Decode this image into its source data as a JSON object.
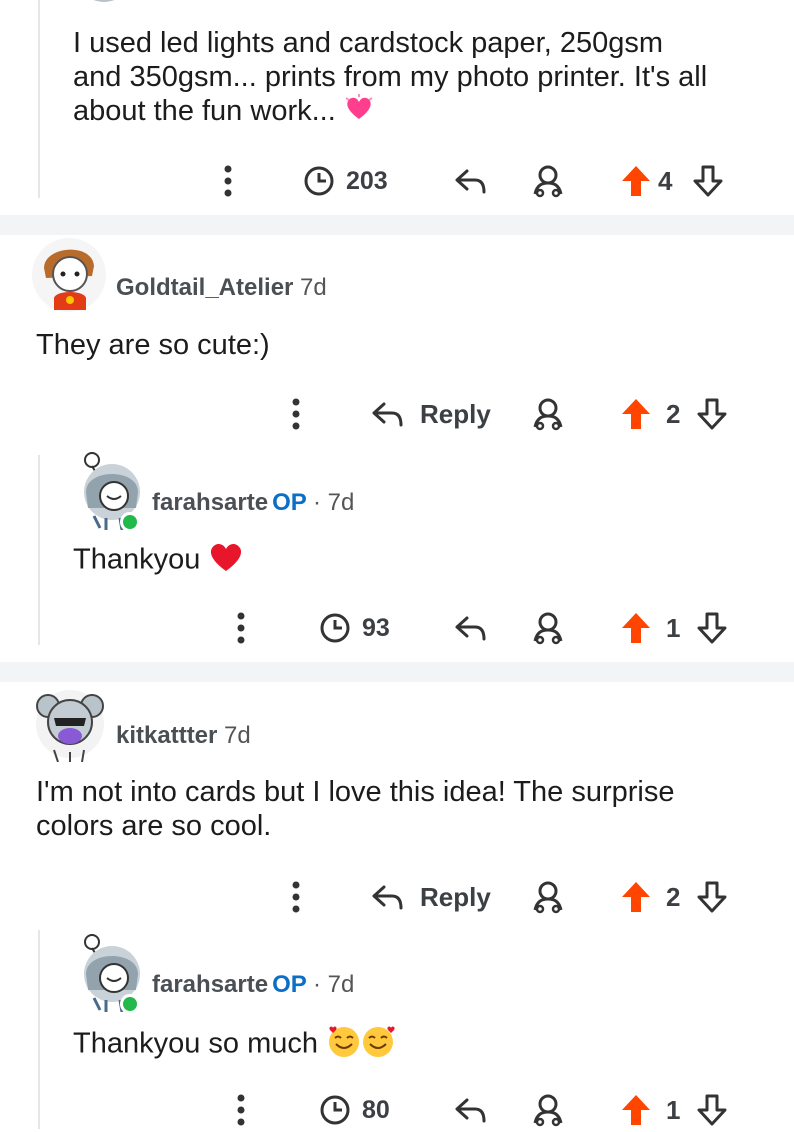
{
  "comments": [
    {
      "text_lines": [
        "I used led lights and cardstock paper, 250gsm",
        "and 350gsm... prints from my photo printer. It's all",
        "about the fun work..."
      ],
      "awards_count": "203",
      "vote_count": "4"
    },
    {
      "username": "Goldtail_Atelier",
      "age": "7d",
      "text": "They are so cute:)",
      "reply_label": "Reply",
      "vote_count": "2"
    },
    {
      "username": "farahsarte",
      "op_badge": "OP",
      "separator": "·",
      "age": "7d",
      "text": "Thankyou",
      "awards_count": "93",
      "vote_count": "1"
    },
    {
      "username": "kitkattter",
      "age": "7d",
      "text_lines": [
        "I'm not into cards but I love this idea! The surprise",
        "colors are so cool."
      ],
      "reply_label": "Reply",
      "vote_count": "2"
    },
    {
      "username": "farahsarte",
      "op_badge": "OP",
      "separator": "·",
      "age": "7d",
      "text": "Thankyou so much",
      "awards_count": "80",
      "vote_count": "1"
    }
  ],
  "icons": {
    "more": "more-vertical-icon",
    "award": "award-clock-icon",
    "reply": "reply-arrow-icon",
    "share": "share-people-icon",
    "upvote": "upvote-arrow-icon",
    "downvote": "downvote-arrow-icon"
  },
  "colors": {
    "upvote": "#ff4500",
    "op": "#0b6ec8",
    "online": "#21b84c",
    "separator": "#f3f4f5"
  }
}
